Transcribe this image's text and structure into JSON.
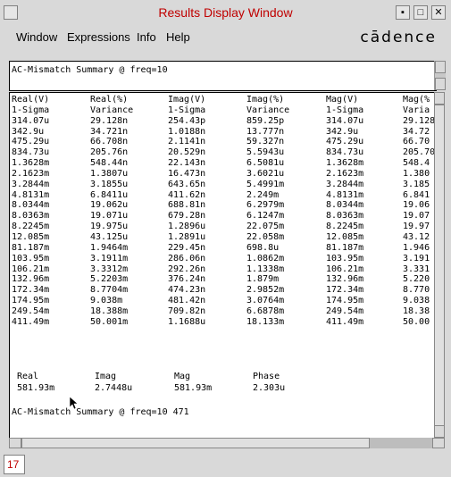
{
  "window": {
    "title": "Results Display Window"
  },
  "menu": {
    "items": [
      "Window",
      "Expressions",
      "Info",
      "Help"
    ],
    "logo": "cādence"
  },
  "summary_header": "AC-Mismatch Summary @ freq=10",
  "table": {
    "columns": [
      {
        "header": "Real(V)",
        "sub": "1-Sigma",
        "values": [
          "314.07u",
          "342.9u",
          "475.29u",
          "834.73u",
          "1.3628m",
          "2.1623m",
          "3.2844m",
          "4.8131m",
          "8.0344m",
          "8.0363m",
          "8.2245m",
          "12.085m",
          "81.187m",
          "103.95m",
          "106.21m",
          "132.96m",
          "172.34m",
          "174.95m",
          "249.54m",
          "411.49m"
        ]
      },
      {
        "header": "Real(%)",
        "sub": "Variance",
        "values": [
          "29.128n",
          "34.721n",
          "66.708n",
          "205.76n",
          "548.44n",
          "1.3807u",
          "3.1855u",
          "6.8411u",
          "19.062u",
          "19.071u",
          "19.975u",
          "43.125u",
          "1.9464m",
          "3.1911m",
          "3.3312m",
          "5.2203m",
          "8.7704m",
          "9.038m",
          "18.388m",
          "50.001m"
        ]
      },
      {
        "header": "Imag(V)",
        "sub": "1-Sigma",
        "values": [
          "254.43p",
          "1.0188n",
          "2.1141n",
          "20.529n",
          "22.143n",
          "16.473n",
          "643.65n",
          "411.62n",
          "688.81n",
          "679.28n",
          "1.2896u",
          "1.2891u",
          "229.45n",
          "286.06n",
          "292.26n",
          "376.24n",
          "474.23n",
          "481.42n",
          "709.82n",
          "1.1688u"
        ]
      },
      {
        "header": "Imag(%)",
        "sub": "Variance",
        "values": [
          "859.25p",
          "13.777n",
          "59.327n",
          "5.5943u",
          "6.5081u",
          "3.6021u",
          "5.4991m",
          "2.249m",
          "6.2979m",
          "6.1247m",
          "22.075m",
          "22.058m",
          "698.8u",
          "1.0862m",
          "1.1338m",
          "1.879m",
          "2.9852m",
          "3.0764m",
          "6.6878m",
          "18.133m"
        ]
      },
      {
        "header": "Mag(V)",
        "sub": "1-Sigma",
        "values": [
          "314.07u",
          "342.9u",
          "475.29u",
          "834.73u",
          "1.3628m",
          "2.1623m",
          "3.2844m",
          "4.8131m",
          "8.0344m",
          "8.0363m",
          "8.2245m",
          "12.085m",
          "81.187m",
          "103.95m",
          "106.21m",
          "132.96m",
          "172.34m",
          "174.95m",
          "249.54m",
          "411.49m"
        ]
      },
      {
        "header": "Mag(%",
        "sub": "Varia",
        "values": [
          "29.128",
          "34.72",
          "66.70",
          "205.70",
          "548.4",
          "1.380",
          "3.185",
          "6.841",
          "19.06",
          "19.07",
          "19.97",
          "43.12",
          "1.946",
          "3.191",
          "3.331",
          "5.220",
          "8.770",
          "9.038",
          "18.38",
          "50.00"
        ]
      }
    ]
  },
  "totals": {
    "labels": [
      "Real",
      "Imag",
      "Mag",
      "Phase"
    ],
    "values": [
      "581.93m",
      "2.7448u",
      "581.93m",
      "2.303u"
    ]
  },
  "footer_line": "AC-Mismatch Summary @ freq=10 471",
  "status": {
    "number": "17"
  }
}
